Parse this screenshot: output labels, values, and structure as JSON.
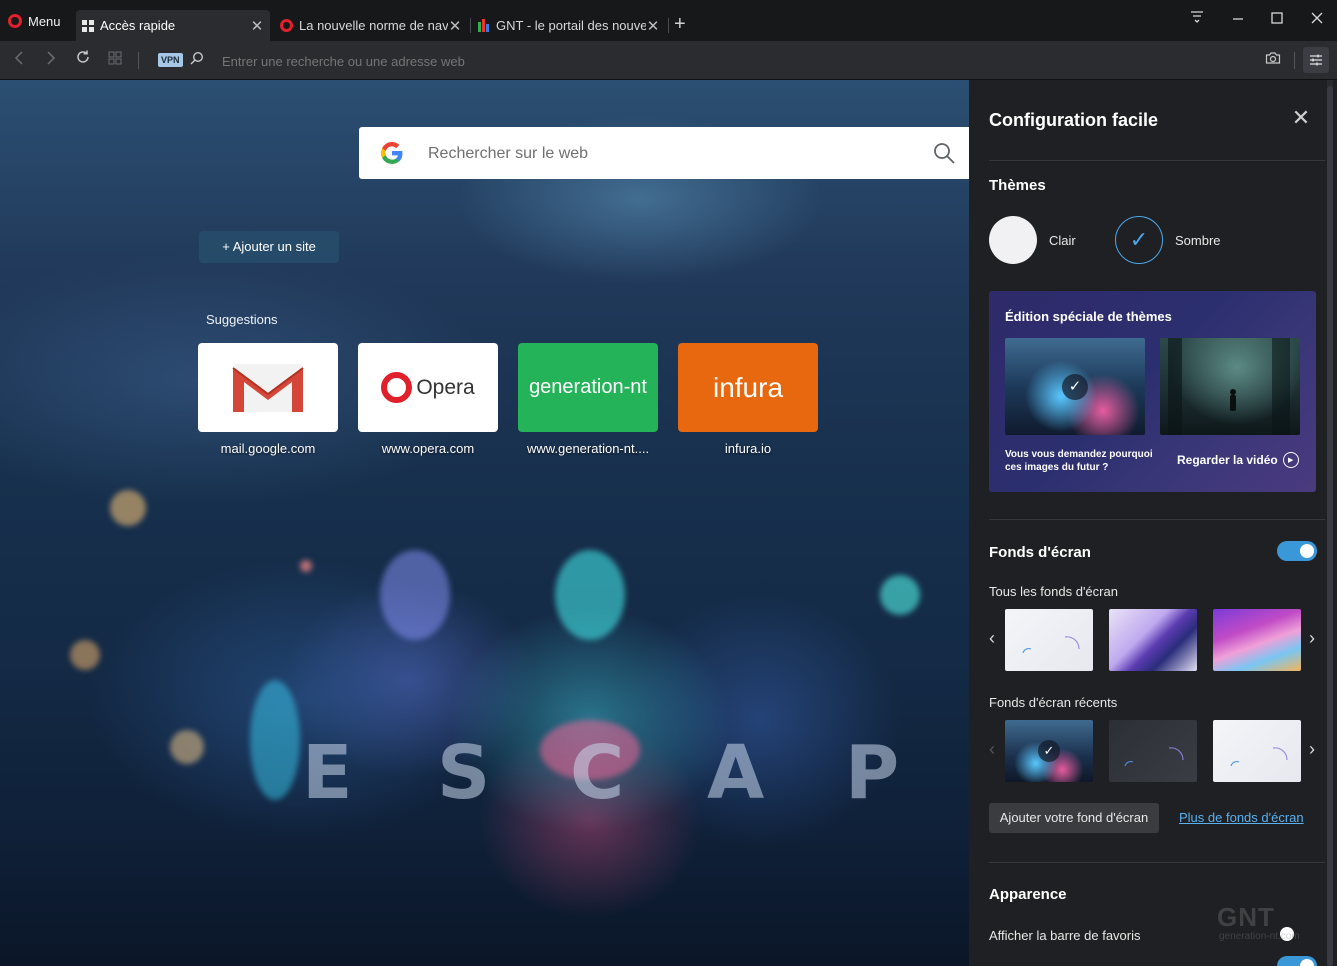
{
  "browser": {
    "menu_label": "Menu",
    "tabs": [
      {
        "label": "Accès rapide",
        "active": true
      },
      {
        "label": "La nouvelle norme de navig",
        "active": false
      },
      {
        "label": "GNT - le portail des nouvel",
        "active": false
      }
    ],
    "address_placeholder": "Entrer une recherche ou une adresse web",
    "vpn_label": "VPN",
    "accent_color": "#e0202b"
  },
  "speed_dial": {
    "search_placeholder": "Rechercher sur le web",
    "add_site_label": "+  Ajouter un site",
    "suggestions_title": "Suggestions",
    "tiles": [
      {
        "label": "mail.google.com",
        "color": "#ffffff"
      },
      {
        "label": "www.opera.com",
        "logo_text": "Opera",
        "color": "#ffffff"
      },
      {
        "label": "www.generation-nt....",
        "logo_text": "generation-nt",
        "color": "#25b35a"
      },
      {
        "label": "infura.io",
        "logo_text": "infura",
        "color": "#e8680f"
      }
    ],
    "wallpaper_letters": [
      "E",
      "S",
      "C",
      "A",
      "P"
    ]
  },
  "easy_setup": {
    "title": "Configuration facile",
    "themes": {
      "title": "Thèmes",
      "options": [
        {
          "label": "Clair",
          "selected": false
        },
        {
          "label": "Sombre",
          "selected": true
        }
      ]
    },
    "promo": {
      "title": "Édition spéciale de thèmes",
      "question": "Vous vous demandez pourquoi ces images du futur ?",
      "video_label": "Regarder la vidéo"
    },
    "wallpapers": {
      "title": "Fonds d'écran",
      "enabled": true,
      "all_label": "Tous les fonds d'écran",
      "recent_label": "Fonds d'écran récents",
      "add_button": "Ajouter votre fond d'écran",
      "more_link": "Plus de fonds d'écran"
    },
    "appearance": {
      "title": "Apparence",
      "show_bookmarks_bar": "Afficher la barre de favoris"
    }
  },
  "watermark": {
    "logo": "GNT",
    "sub": "generation-nt.com"
  }
}
